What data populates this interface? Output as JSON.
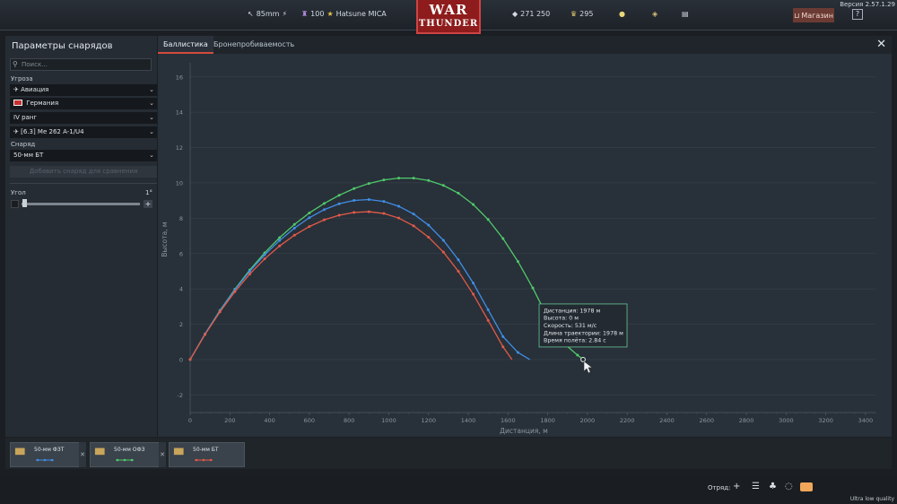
{
  "topbar": {
    "ammo": "85mm",
    "level": "100",
    "player": "Hatsune MICA",
    "logo_line1": "WAR",
    "logo_line2": "THUNDER",
    "silver": "271 250",
    "gold": "295",
    "shop": "Магазин",
    "help": "?",
    "version": "Версия 2.57.1.29"
  },
  "left_panel": {
    "title": "Параметры снарядов",
    "search_placeholder": "Поиск...",
    "threat_label": "Угроза",
    "threat_type": "Авиация",
    "nation": "Германия",
    "rank": "IV ранг",
    "vehicle": "[6.3] Me 262 A-1/U4",
    "shell_label": "Снаряд",
    "shell": "50-мм БТ",
    "add_button": "Добавить снаряд для сравнения",
    "angle_label": "Угол",
    "angle_value": "1°",
    "plus": "+"
  },
  "tabs": [
    {
      "label": "Баллистика",
      "active": true
    },
    {
      "label": "Бронепробиваемость",
      "active": false
    }
  ],
  "close_label": "✕",
  "chart_data": {
    "type": "line",
    "xlabel": "Дистанция, м",
    "ylabel": "Высота, м",
    "xlim": [
      0,
      3450
    ],
    "ylim": [
      -3,
      16.6
    ],
    "xticks": [
      0,
      200,
      400,
      600,
      800,
      1000,
      1200,
      1400,
      1600,
      1800,
      2000,
      2200,
      2400,
      2600,
      2800,
      3000,
      3200,
      3400
    ],
    "yticks": [
      -2,
      0,
      2,
      4,
      6,
      8,
      10,
      12,
      14,
      16
    ],
    "grid": true,
    "series": [
      {
        "color": "#4fca6a",
        "x": [
          0,
          75,
          150,
          225,
          300,
          375,
          450,
          525,
          600,
          675,
          750,
          825,
          900,
          975,
          1050,
          1125,
          1200,
          1275,
          1350,
          1425,
          1500,
          1575,
          1650,
          1725,
          1800,
          1875,
          1950,
          1978
        ],
        "y": [
          0,
          1.45,
          2.78,
          3.98,
          5.07,
          6.04,
          6.9,
          7.65,
          8.3,
          8.84,
          9.3,
          9.68,
          9.97,
          10.17,
          10.27,
          10.27,
          10.14,
          9.86,
          9.42,
          8.78,
          7.93,
          6.85,
          5.55,
          4.05,
          2.38,
          0.98,
          0.25,
          0
        ]
      },
      {
        "color": "#3f8ee6",
        "x": [
          0,
          75,
          150,
          225,
          300,
          375,
          450,
          525,
          600,
          675,
          750,
          825,
          900,
          975,
          1050,
          1125,
          1200,
          1275,
          1350,
          1425,
          1500,
          1575,
          1650,
          1710
        ],
        "y": [
          0,
          1.45,
          2.76,
          3.95,
          5.0,
          5.93,
          6.74,
          7.44,
          8.03,
          8.49,
          8.82,
          9.01,
          9.06,
          8.95,
          8.68,
          8.24,
          7.61,
          6.75,
          5.65,
          4.33,
          2.82,
          1.3,
          0.4,
          0
        ]
      },
      {
        "color": "#e35a48",
        "x": [
          0,
          75,
          150,
          225,
          300,
          375,
          450,
          525,
          600,
          675,
          750,
          825,
          900,
          975,
          1050,
          1125,
          1200,
          1275,
          1350,
          1425,
          1500,
          1575,
          1620
        ],
        "y": [
          0,
          1.42,
          2.7,
          3.84,
          4.84,
          5.7,
          6.43,
          7.04,
          7.53,
          7.91,
          8.17,
          8.33,
          8.37,
          8.27,
          8.01,
          7.57,
          6.93,
          6.08,
          5.0,
          3.7,
          2.22,
          0.72,
          0
        ]
      }
    ],
    "tooltip": {
      "lines": [
        "Дистанция: 1978 м",
        "Высота: 0 м",
        "Скорость: 531 м/с",
        "Длина траектории: 1978 м",
        "Время полёта: 2.84 с"
      ]
    }
  },
  "ammo_cards": [
    {
      "name": "50-мм ФЗТ",
      "color": "#3f8ee6"
    },
    {
      "name": "50-мм ОФЗ",
      "color": "#4fca6a"
    },
    {
      "name": "50-мм БТ",
      "color": "#e35a48"
    }
  ],
  "ammo_close": "✕",
  "footer": {
    "squad": "Отряд:",
    "quality": "Ultra low quality"
  }
}
